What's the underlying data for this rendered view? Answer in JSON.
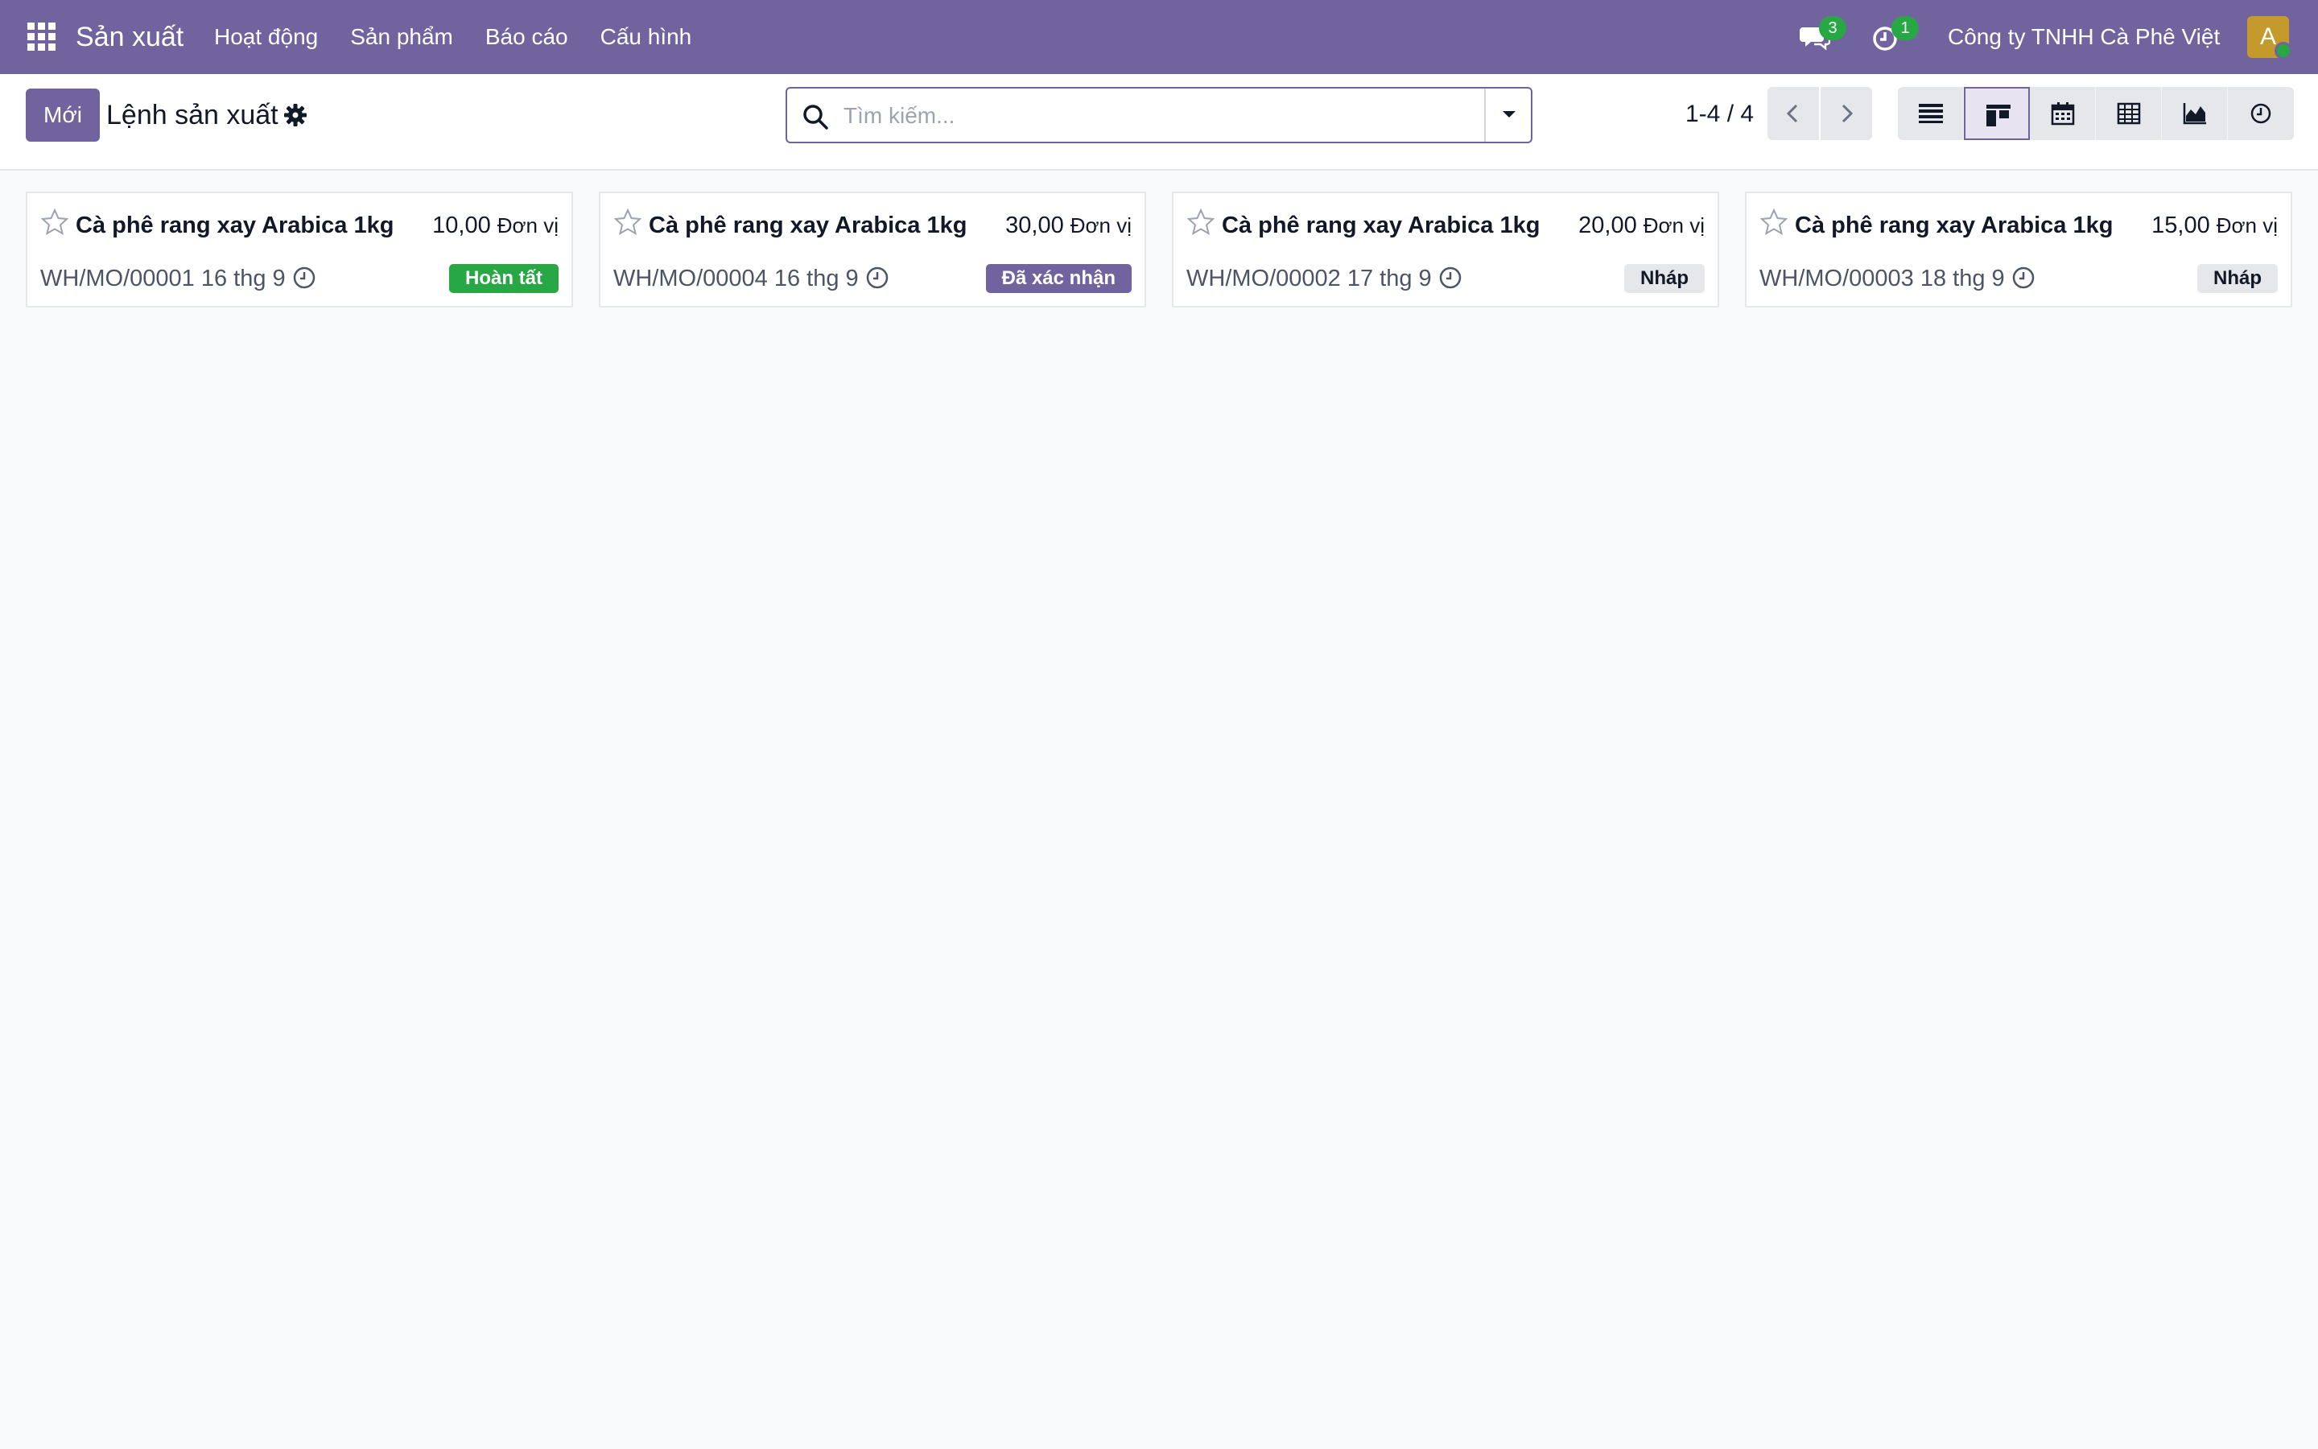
{
  "navbar": {
    "app_name": "Sản xuất",
    "menu": [
      "Hoạt động",
      "Sản phẩm",
      "Báo cáo",
      "Cấu hình"
    ],
    "messages_count": "3",
    "activities_count": "1",
    "company": "Công ty TNHH Cà Phê Việt",
    "avatar_initial": "A"
  },
  "control_panel": {
    "new_label": "Mới",
    "title": "Lệnh sản xuất",
    "search_placeholder": "Tìm kiếm...",
    "pager": "1-4 / 4",
    "views": [
      "list-view-icon",
      "kanban-view-icon",
      "calendar-view-icon",
      "pivot-view-icon",
      "graph-view-icon",
      "activity-view-icon"
    ],
    "active_view": "kanban-view-icon"
  },
  "cards": [
    {
      "product": "Cà phê rang xay Arabica 1kg",
      "qty": "10,00",
      "uom": "Đơn vị",
      "ref": "WH/MO/00001 16 thg 9",
      "status": "Hoàn tất",
      "status_color": "#28a745"
    },
    {
      "product": "Cà phê rang xay Arabica 1kg",
      "qty": "30,00",
      "uom": "Đơn vị",
      "ref": "WH/MO/00004 16 thg 9",
      "status": "Đã xác nhận",
      "status_color": "#71639e"
    },
    {
      "product": "Cà phê rang xay Arabica 1kg",
      "qty": "20,00",
      "uom": "Đơn vị",
      "ref": "WH/MO/00002 17 thg 9",
      "status": "Nháp",
      "status_color": "#e5e7eb"
    },
    {
      "product": "Cà phê rang xay Arabica 1kg",
      "qty": "15,00",
      "uom": "Đơn vị",
      "ref": "WH/MO/00003 18 thg 9",
      "status": "Nháp",
      "status_color": "#e5e7eb"
    }
  ],
  "colors": {
    "brand": "#71639e",
    "success": "#28a745"
  }
}
